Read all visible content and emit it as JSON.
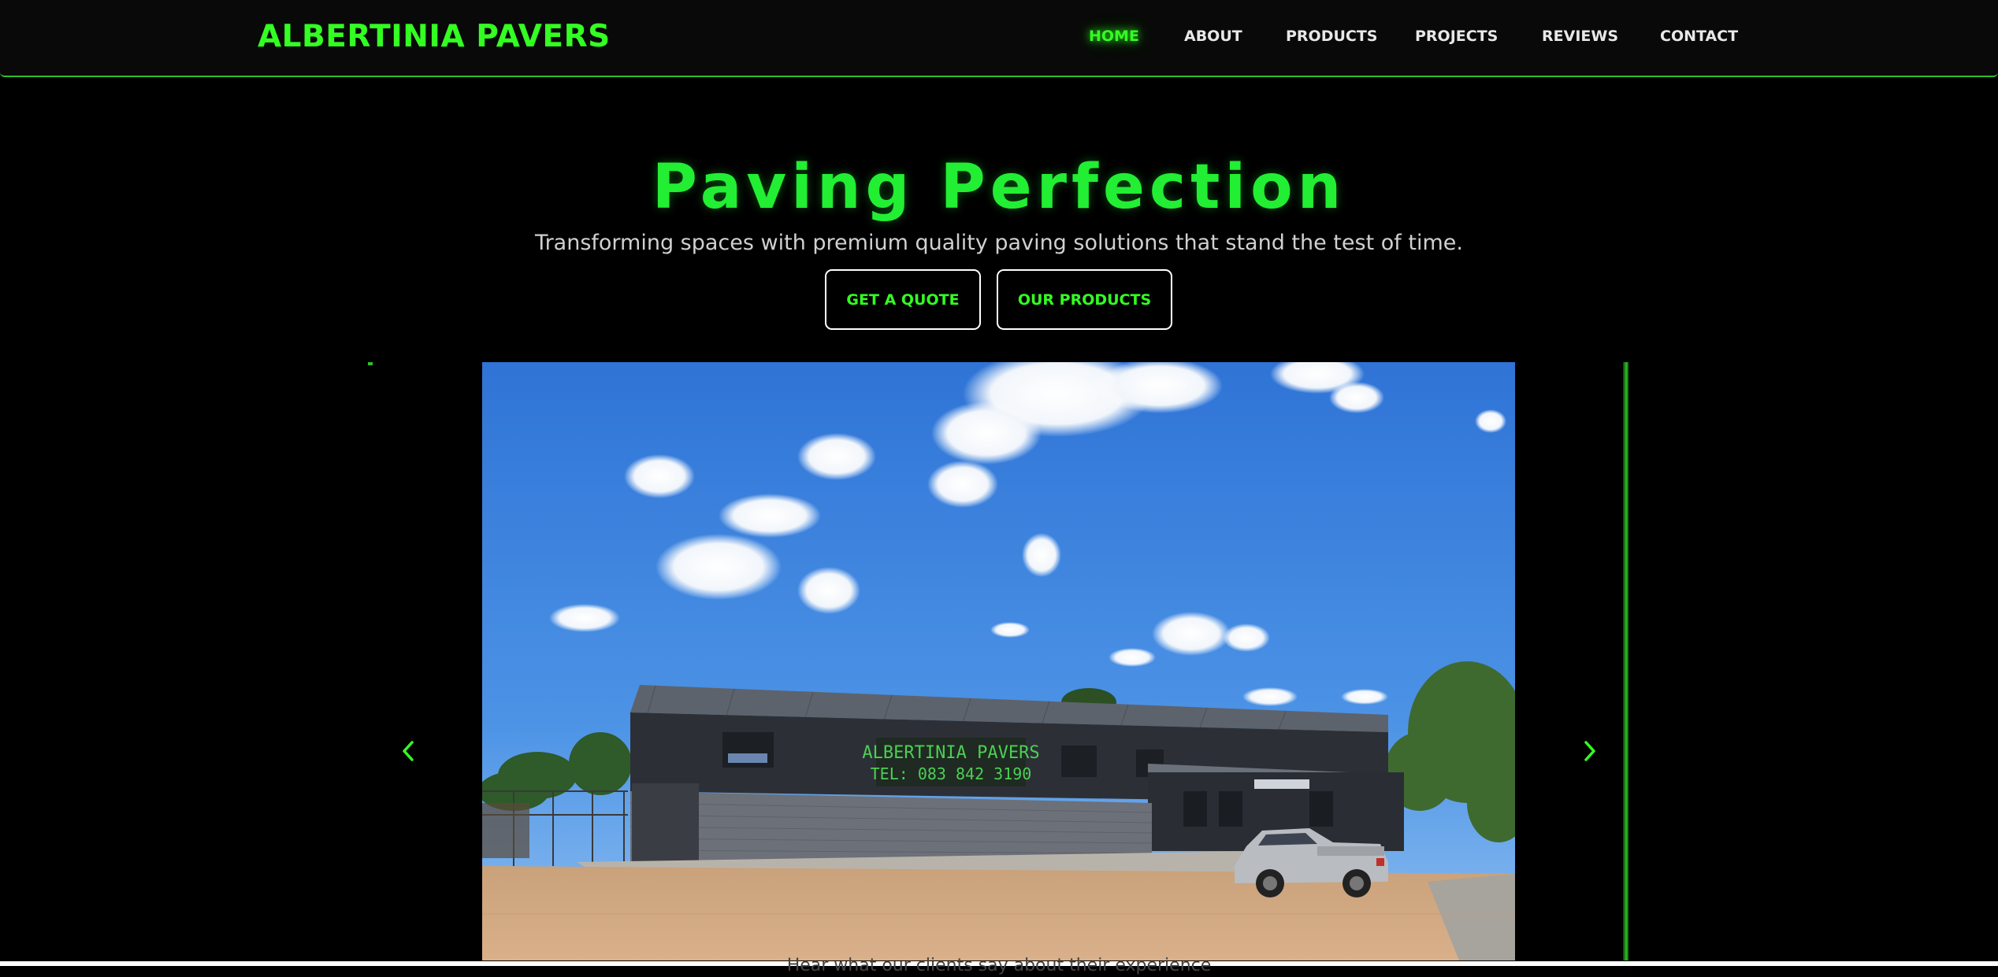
{
  "brand": {
    "logo_text": "ALBERTINIA PAVERS",
    "accent_color": "#33ff22",
    "background_color": "#000000"
  },
  "nav": {
    "items": [
      {
        "label": "HOME",
        "active": true
      },
      {
        "label": "ABOUT",
        "active": false
      },
      {
        "label": "PRODUCTS",
        "active": false
      },
      {
        "label": "PROJECTS",
        "active": false
      },
      {
        "label": "REVIEWS",
        "active": false
      },
      {
        "label": "CONTACT",
        "active": false
      }
    ]
  },
  "hero": {
    "title": "Paving Perfection",
    "subtitle": "Transforming spaces with premium quality paving solutions that stand the test of time.",
    "buttons": {
      "quote_label": "GET A QUOTE",
      "products_label": "OUR PRODUCTS"
    }
  },
  "slider": {
    "prev_icon": "chevron-left-icon",
    "next_icon": "chevron-right-icon",
    "slide": {
      "sign_line1": "ALBERTINIA PAVERS",
      "sign_line2": "TEL: 083 842 3190"
    }
  },
  "reviews": {
    "intro_peek": "Hear what our clients say about their experience"
  }
}
